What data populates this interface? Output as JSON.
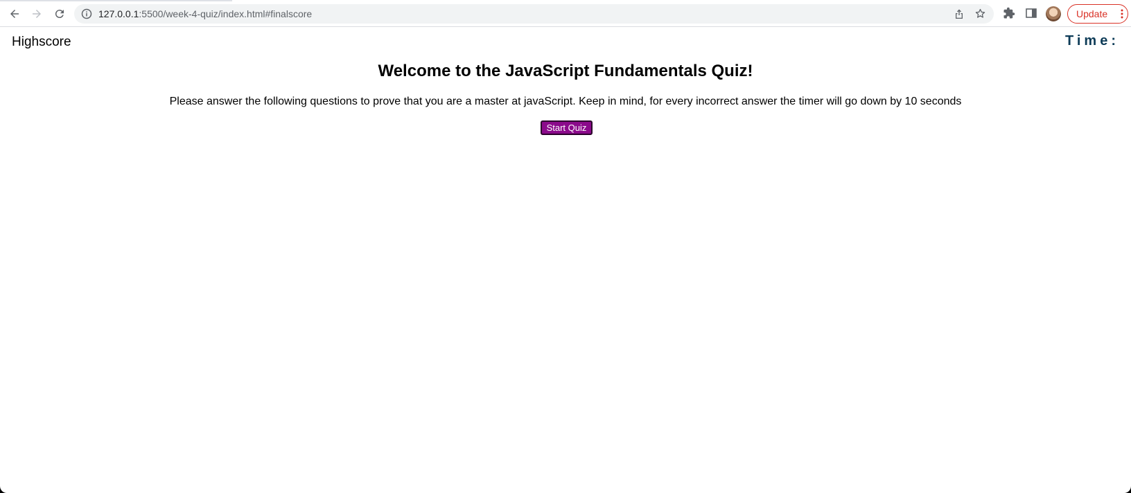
{
  "browser": {
    "url_host": "127.0.0.1",
    "url_rest": ":5500/week-4-quiz/index.html#finalscore",
    "update_label": "Update"
  },
  "icons": {
    "back": "back-arrow-icon",
    "forward": "forward-arrow-icon",
    "reload": "reload-icon",
    "info": "info-icon",
    "share": "share-icon",
    "bookmark": "star-icon",
    "extensions": "puzzle-icon",
    "side_panel": "side-panel-icon",
    "menu": "kebab-menu-icon"
  },
  "page": {
    "highscore_label": "Highscore",
    "timer_label": "Time:",
    "title": "Welcome to the JavaScript Fundamentals Quiz!",
    "intro": "Please answer the following questions to prove that you are a master at javaScript. Keep in mind, for every incorrect answer the timer will go down by 10 seconds",
    "start_button": "Start Quiz"
  },
  "colors": {
    "button_bg": "#8b0a8b",
    "timer_text": "#0d3b57",
    "update_accent": "#d93025"
  }
}
